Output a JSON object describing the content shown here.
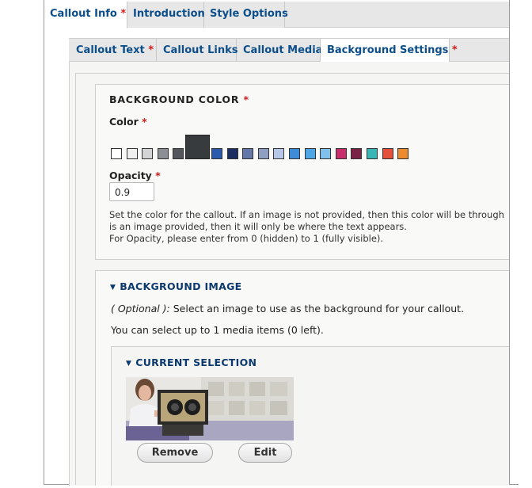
{
  "top_tabs": [
    {
      "label": "Callout Info",
      "required": "*"
    },
    {
      "label": "Introduction"
    },
    {
      "label": "Style Options"
    }
  ],
  "sub_tabs": [
    {
      "label": "Callout Text",
      "required": "*"
    },
    {
      "label": "Callout Links"
    },
    {
      "label": "Callout Media"
    },
    {
      "label": "Background Settings",
      "required": "*"
    }
  ],
  "background_color": {
    "legend": "BACKGROUND COLOR",
    "required": "*",
    "color_label": "Color",
    "swatches": [
      "#ffffff",
      "#f0f0f0",
      "#d2d4d6",
      "#8c9095",
      "#53575b",
      "#383b3e",
      "#2a5aab",
      "#1c2e60",
      "#6378a8",
      "#8e9fc2",
      "#b6c6e6",
      "#3e8bd6",
      "#4fa6e4",
      "#7fc1ec",
      "#c92f6a",
      "#7a2445",
      "#39b5b5",
      "#e5503b",
      "#ee8b2f"
    ],
    "selected_swatch": "#383b3e",
    "opacity_label": "Opacity",
    "opacity_value": "0.9",
    "description_line1": "Set the color for the callout. If an image is not provided, then this color will be through",
    "description_line2": "is an image provided, then it will only be where the text appears.",
    "description_line3": "For Opacity, please enter from 0 (hidden) to 1 (fully visible)."
  },
  "background_image": {
    "summary": "BACKGROUND IMAGE",
    "optional_label": "( Optional ):",
    "description": " Select an image to use as the background for your callout.",
    "limit_text": "You can select up to 1 media items (0 left).",
    "current_selection": {
      "summary": "CURRENT SELECTION",
      "remove_label": "Remove",
      "edit_label": "Edit"
    }
  },
  "colors": {
    "link_blue": "#0c4e8a",
    "required_red": "#d21b1b"
  }
}
